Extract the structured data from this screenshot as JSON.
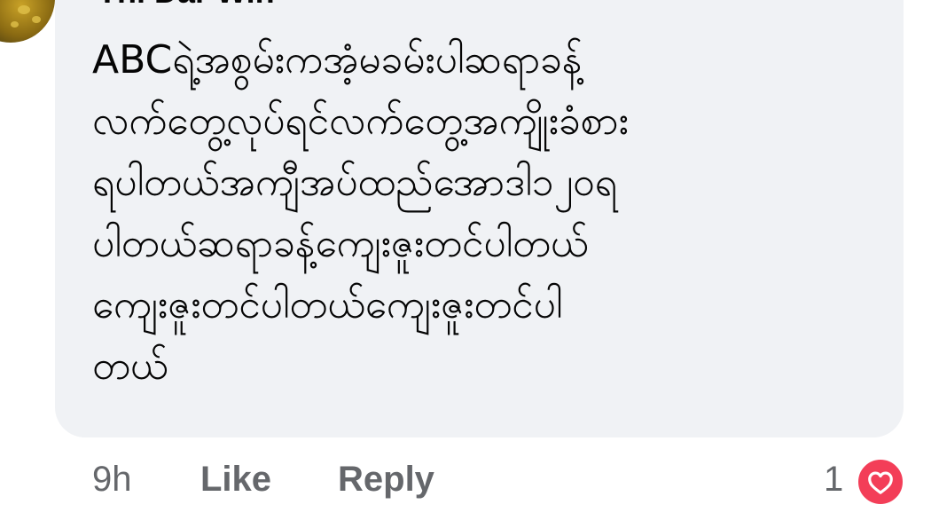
{
  "comment": {
    "author": "Thi Dar Win",
    "text": "ABCရဲ့အစွမ်းကအံ့မခမ်းပါဆရာခန့်\nလက်တွေ့လုပ်ရင်လက်တွေ့အကျိုးခံစား\nရပါတယ်အကျီအပ်ထည်အောဒါ၁၂၀ရ\nပါတယ်ဆရာခန့်ကျေးဇူးတင်ပါတယ်\nကျေးဇူးတင်ပါတယ်ကျေးဇူးတင်ပါ\nတယ်"
  },
  "actions": {
    "timestamp": "9h",
    "like_label": "Like",
    "reply_label": "Reply",
    "reaction_count": "1"
  },
  "icons": {
    "reaction": "heart-icon",
    "reaction_color": "#f33e58"
  }
}
